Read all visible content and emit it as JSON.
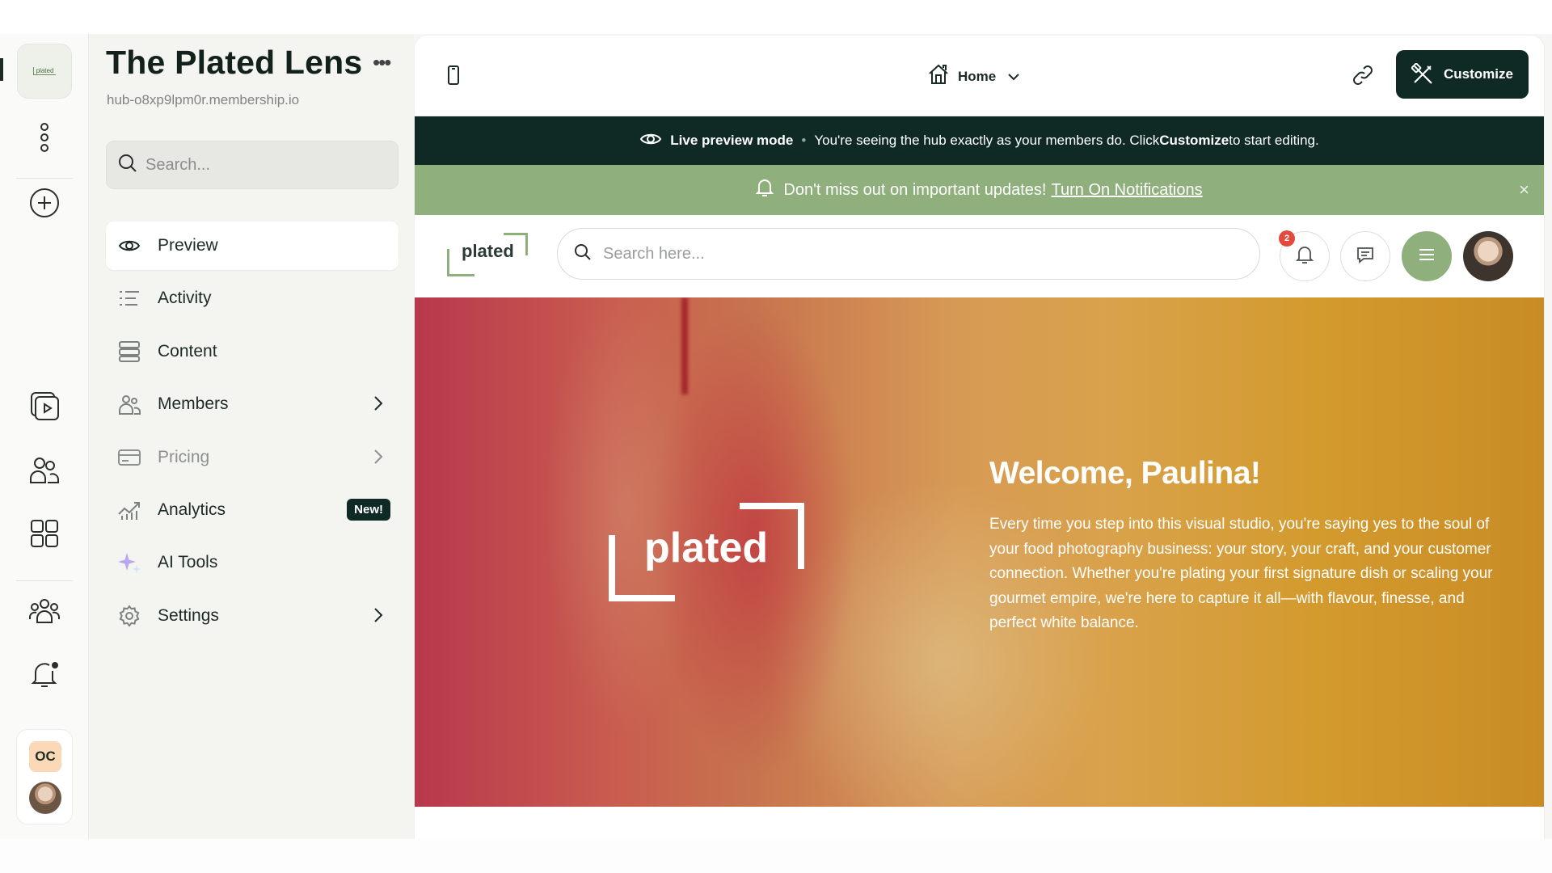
{
  "hub": {
    "title": "The Plated Lens",
    "url": "hub-o8xp9lpm0r.membership.io",
    "more_icon": "ellipsis-icon"
  },
  "rail": {
    "logo_text": "plated",
    "user_initials": "OC",
    "icons": [
      "kebab-icon",
      "add-circle-icon",
      "media-library-icon",
      "members-icon",
      "apps-grid-icon",
      "community-icon",
      "notification-bell-icon"
    ]
  },
  "sidebar": {
    "search_placeholder": "Search...",
    "nav": [
      {
        "label": "Preview",
        "icon": "eye-icon",
        "active": true
      },
      {
        "label": "Activity",
        "icon": "activity-list-icon"
      },
      {
        "label": "Content",
        "icon": "content-stack-icon"
      },
      {
        "label": "Members",
        "icon": "members-icon",
        "chevron": true
      },
      {
        "label": "Pricing",
        "icon": "credit-card-icon",
        "chevron": true,
        "muted": true
      },
      {
        "label": "Analytics",
        "icon": "analytics-chart-icon",
        "badge": "New!"
      },
      {
        "label": "AI Tools",
        "icon": "sparkle-icon"
      },
      {
        "label": "Settings",
        "icon": "gear-icon",
        "chevron": true
      }
    ]
  },
  "toolbar": {
    "page_label": "Home",
    "customize_label": "Customize"
  },
  "live_bar": {
    "title": "Live preview mode",
    "separator": "•",
    "text_before": "You're seeing the hub exactly as your members do. Click ",
    "text_bold": "Customize",
    "text_after": " to start editing."
  },
  "notification_bar": {
    "text": "Don't miss out on important updates!",
    "link": "Turn On Notifications",
    "close": "×"
  },
  "site": {
    "logo_text": "plated",
    "search_placeholder": "Search here...",
    "notification_count": "2"
  },
  "hero": {
    "logo_text": "plated",
    "title": "Welcome, Paulina!",
    "body": "Every time you step into this visual studio, you're saying yes to the soul of your food photography business: your story, your craft, and your customer connection. Whether you're plating your first signature dish or scaling your gourmet empire, we're here to capture it all—with flavour, finesse, and perfect white balance."
  },
  "colors": {
    "brand_dark": "#0f2a24",
    "brand_green": "#8fb07c",
    "badge_red": "#e04b3e",
    "initials_bg": "#fcd9b6"
  }
}
